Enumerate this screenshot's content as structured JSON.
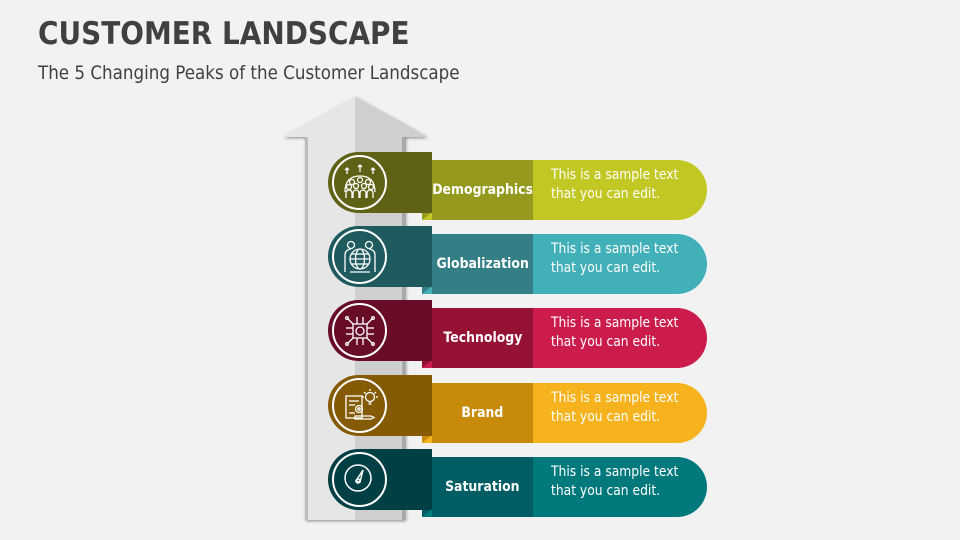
{
  "header": {
    "title": "CUSTOMER LANDSCAPE",
    "subtitle": "The 5 Changing Peaks of the Customer Landscape"
  },
  "arrow": {
    "colors": {
      "light": "#e6e6e6",
      "dark": "#cfcfcf"
    }
  },
  "items": [
    {
      "label": "Demographics",
      "text_line1": "This is a sample text",
      "text_line2": "that you can edit.",
      "icon": "crowd-growth-icon",
      "colors": {
        "dark": "#5f6115",
        "mid": "#959a1f",
        "light": "#c2c823"
      }
    },
    {
      "label": "Globalization",
      "text_line1": "This is a sample text",
      "text_line2": "that you can edit.",
      "icon": "globe-people-icon",
      "colors": {
        "dark": "#1f5a5e",
        "mid": "#347f86",
        "light": "#42b0b9"
      }
    },
    {
      "label": "Technology",
      "text_line1": "This is a sample text",
      "text_line2": "that you can edit.",
      "icon": "circuit-chip-icon",
      "colors": {
        "dark": "#680c28",
        "mid": "#951235",
        "light": "#cc1c4c"
      }
    },
    {
      "label": "Brand",
      "text_line1": "This is a sample text",
      "text_line2": "that you can edit.",
      "icon": "brand-idea-icon",
      "colors": {
        "dark": "#855a05",
        "mid": "#c88a0a",
        "light": "#f7b31d"
      }
    },
    {
      "label": "Saturation",
      "text_line1": "This is a sample text",
      "text_line2": "that you can edit.",
      "icon": "gauge-icon",
      "colors": {
        "dark": "#003f44",
        "mid": "#005d63",
        "light": "#00797d"
      }
    }
  ]
}
